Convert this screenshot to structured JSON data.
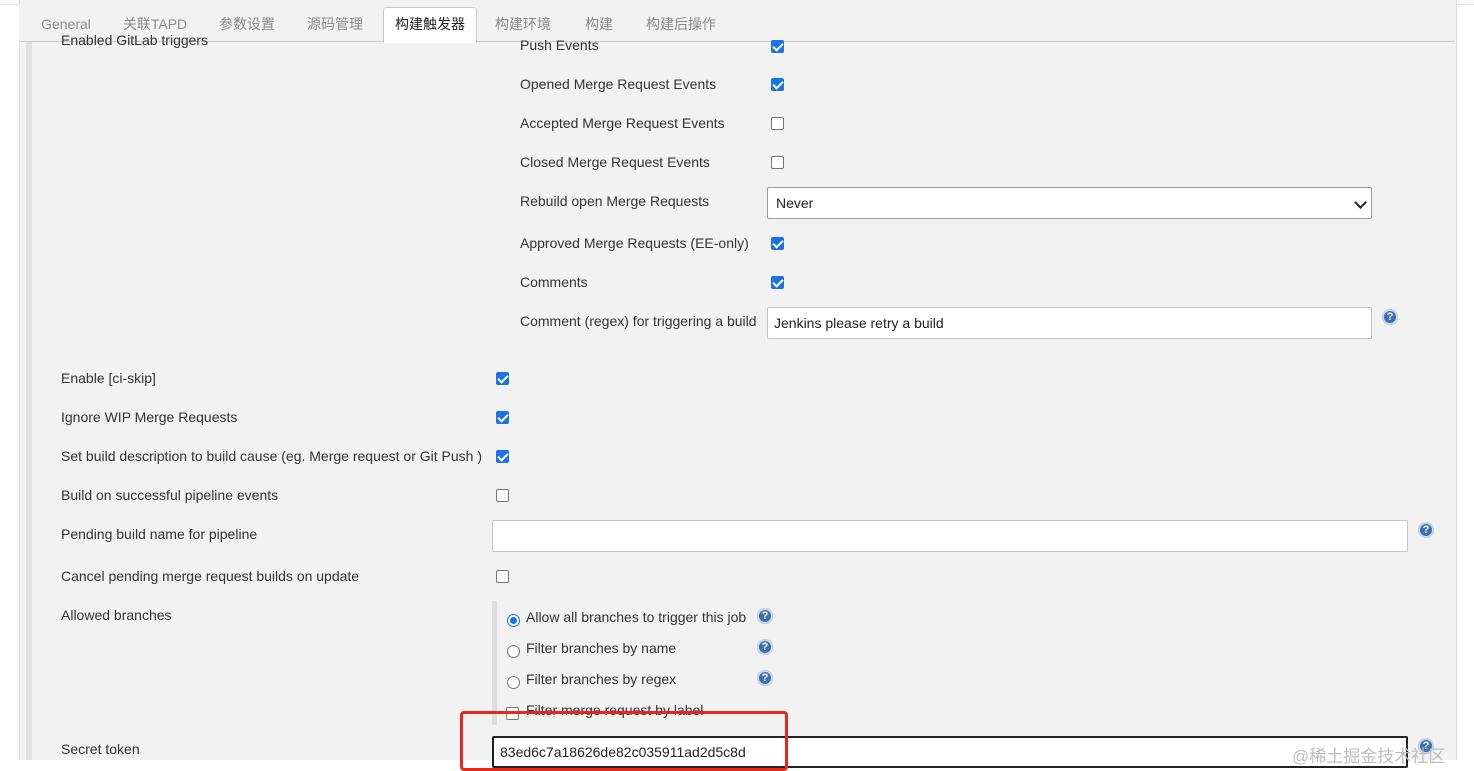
{
  "tabs": [
    {
      "label": "General",
      "active": false
    },
    {
      "label": "关联TAPD",
      "active": false
    },
    {
      "label": "参数设置",
      "active": false
    },
    {
      "label": "源码管理",
      "active": false
    },
    {
      "label": "构建触发器",
      "active": true
    },
    {
      "label": "构建环境",
      "active": false
    },
    {
      "label": "构建",
      "active": false
    },
    {
      "label": "构建后操作",
      "active": false
    }
  ],
  "gitlab_triggers": {
    "label": "Enabled GitLab triggers",
    "push_events": {
      "label": "Push Events",
      "checked": true
    },
    "opened_mr_events": {
      "label": "Opened Merge Request Events",
      "checked": true
    },
    "accepted_mr_events": {
      "label": "Accepted Merge Request Events",
      "checked": false
    },
    "closed_mr_events": {
      "label": "Closed Merge Request Events",
      "checked": false
    },
    "rebuild_open_mr": {
      "label": "Rebuild open Merge Requests",
      "value": "Never"
    },
    "approved_mr": {
      "label": "Approved Merge Requests (EE-only)",
      "checked": true
    },
    "comments": {
      "label": "Comments",
      "checked": true
    },
    "comment_regex": {
      "label": "Comment (regex) for triggering a build",
      "value": "Jenkins please retry a build"
    }
  },
  "options": {
    "ci_skip": {
      "label": "Enable [ci-skip]",
      "checked": true
    },
    "ignore_wip": {
      "label": "Ignore WIP Merge Requests",
      "checked": true
    },
    "set_description": {
      "label": "Set build description to build cause (eg. Merge request or Git Push )",
      "checked": true
    },
    "build_on_pipeline": {
      "label": "Build on successful pipeline events",
      "checked": false
    },
    "pending_build_name": {
      "label": "Pending build name for pipeline",
      "value": ""
    },
    "cancel_pending": {
      "label": "Cancel pending merge request builds on update",
      "checked": false
    }
  },
  "allowed_branches": {
    "label": "Allowed branches",
    "options": [
      {
        "label": "Allow all branches to trigger this job",
        "selected": true
      },
      {
        "label": "Filter branches by name",
        "selected": false
      },
      {
        "label": "Filter branches by regex",
        "selected": false
      }
    ],
    "filter_by_label": {
      "label": "Filter merge request by label",
      "checked": false
    }
  },
  "secret_token": {
    "label": "Secret token",
    "value": "83ed6c7a18626de82c035911ad2d5c8d"
  },
  "help_glyph": "?",
  "watermark": "@稀土掘金技术社区",
  "colors": {
    "accent": "#1a73e8",
    "highlight": "#e8271b",
    "help": "#3f6fb0"
  }
}
